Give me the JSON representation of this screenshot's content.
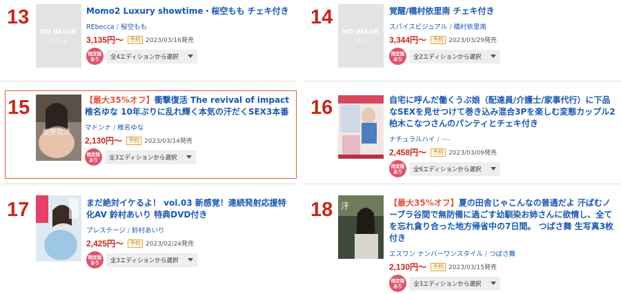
{
  "items": [
    {
      "rank": "13",
      "noimage": {
        "main": "NO IMAGE",
        "sub": "アダルト"
      },
      "promo": "",
      "title": "Momo2 Luxury showtime・桜空もも チェキ付き",
      "maker": "REbecca",
      "actress": "桜空もも",
      "price": "3,135円〜",
      "yoyaku": "予約",
      "date": "2023/03/16発売",
      "badge_top": "限定版",
      "badge_bottom": "あり",
      "edition": "全4エディションから選択"
    },
    {
      "rank": "14",
      "noimage": {
        "main": "NO IMAGE",
        "sub": "アダルト"
      },
      "promo": "",
      "title": "覚醒/橋村依里南 チェキ付き",
      "maker": "スパイスビジュアル",
      "actress": "橋村依里南",
      "price": "3,344円〜",
      "yoyaku": "予約",
      "date": "2023/03/29発売",
      "badge_top": "限定版",
      "badge_bottom": "あり",
      "edition": "全2エディションから選択"
    },
    {
      "rank": "15",
      "promo": "【最大35%オフ】",
      "title": "衝撃復活 The revival of impact 椎名ゆな 10年ぶりに乱れ輝く本気の汗だくSEX3本番",
      "maker": "マドンナ",
      "actress": "椎名ゆな",
      "price": "2,130円〜",
      "yoyaku": "予約",
      "date": "2023/03/14発売",
      "badge_top": "限定版",
      "badge_bottom": "あり",
      "edition": "全3エディションから選択",
      "highlight_color": "#e2553f"
    },
    {
      "rank": "16",
      "promo": "",
      "title": "自宅に呼んだ働くうぶ娘（配達員/介護士/家事代行）に下品なSEXを見せつけて巻き込み混合3Pを楽しむ変態カップル2 柏木こなつさんのパンティとチェキ付き",
      "maker": "ナチュラルハイ",
      "actress": "----",
      "price": "2,458円〜",
      "yoyaku": "予約",
      "date": "2023/03/09発売",
      "badge_top": "限定版",
      "badge_bottom": "あり",
      "edition": "全6エディションから選択"
    },
    {
      "rank": "17",
      "promo": "",
      "title": "まだ絶対イケるよ！ vol.03 新感覚！連続発射応援特化AV 鈴村あいり 特典DVD付き",
      "maker": "プレステージ",
      "actress": "鈴村あいり",
      "price": "2,425円〜",
      "yoyaku": "予約",
      "date": "2023/02/24発売",
      "badge_top": "限定版",
      "badge_bottom": "あり",
      "edition": "全3エディションから選択"
    },
    {
      "rank": "18",
      "promo": "【最大35%オフ】",
      "title": "夏の田舎じゃこんなの普通だよ 汗ばむノーブラ谷間で無防備に過ごす幼馴染お姉さんに欲情し、全てを忘れ貪り合った地方帰省中の7日間。 つばさ舞 生写真3枚付き",
      "maker": "エスワン ナンバーワンスタイル",
      "actress": "つばさ舞",
      "price": "2,130円〜",
      "yoyaku": "予約",
      "date": "2023/03/15発売",
      "badge_top": "限定版",
      "badge_bottom": "あり",
      "edition": "全3エディションから選択"
    }
  ],
  "colors": {
    "rank": "#c8261a",
    "link": "#1a57b0",
    "price": "#c8261a",
    "promo": "#e2553f",
    "badge": "#e0556c"
  }
}
